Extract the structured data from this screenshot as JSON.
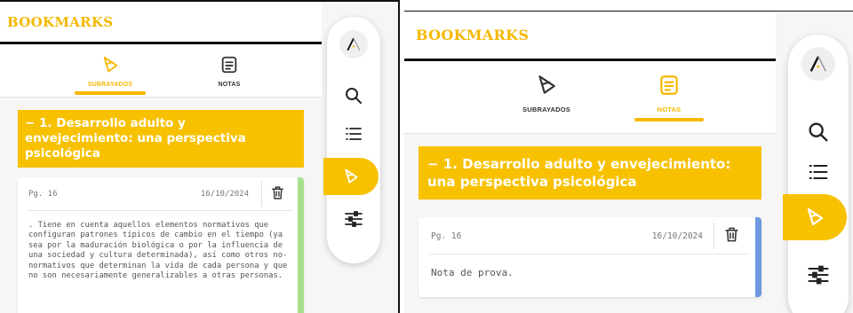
{
  "colors": {
    "accent": "#f7c100",
    "highlight_bar": "#a6e08d",
    "note_bar": "#6f98e0"
  },
  "icons": [
    "highlighter-icon",
    "notes-icon",
    "search-icon",
    "list-icon",
    "sliders-icon",
    "logo-icon",
    "trash-icon"
  ],
  "left": {
    "header": "BOOKMARKS",
    "tabs": {
      "subrayados": "SUBRAYADOS",
      "notas": "NOTAS",
      "active": "subrayados"
    },
    "chapter": "− 1. Desarrollo adulto y envejecimiento: una perspectiva psicológica",
    "card": {
      "page": "Pg. 16",
      "date": "16/10/2024",
      "text": ". Tiene en cuenta aquellos elementos normativos que configuran patrones típicos de cambio en el tiempo (ya sea por la maduración biológica o por la influencia de una sociedad y cultura determinada), así como otros no-normativos que determinan la vida de cada persona y que no son necesariamente generalizables a otras personas."
    }
  },
  "right": {
    "header": "BOOKMARKS",
    "tabs": {
      "subrayados": "SUBRAYADOS",
      "notas": "NOTAS",
      "active": "notas"
    },
    "chapter": "− 1. Desarrollo adulto y envejecimiento: una perspectiva psicológica",
    "card": {
      "page": "Pg. 16",
      "date": "16/10/2024",
      "text": "Nota de prova."
    }
  }
}
